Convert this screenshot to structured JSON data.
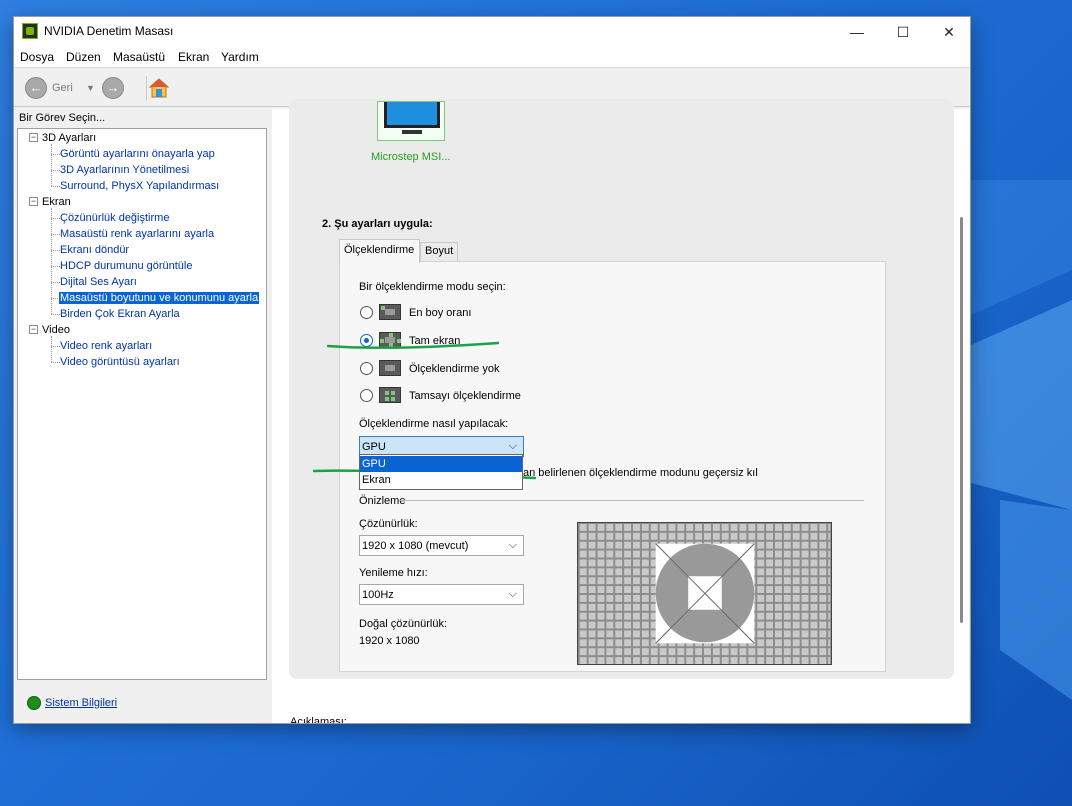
{
  "window": {
    "title": "NVIDIA Denetim Masası",
    "controls": {
      "minimize": "—",
      "maximize": "☐",
      "close": "✕"
    }
  },
  "menu": [
    "Dosya",
    "Düzen",
    "Masaüstü",
    "Ekran",
    "Yardım"
  ],
  "toolbar": {
    "back_label": "Geri",
    "back_icon": "back-arrow-icon",
    "forward_icon": "forward-arrow-icon",
    "home_icon": "home-icon"
  },
  "sidebar": {
    "title": "Bir Görev Seçin...",
    "groups": [
      {
        "label": "3D Ayarları",
        "items": [
          "Görüntü ayarlarını önayarla yap",
          "3D Ayarlarının Yönetilmesi",
          "Surround, PhysX Yapılandırması"
        ]
      },
      {
        "label": "Ekran",
        "items": [
          "Çözünürlük değiştirme",
          "Masaüstü renk ayarlarını ayarla",
          "Ekranı döndür",
          "HDCP durumunu görüntüle",
          "Dijital Ses Ayarı",
          "Masaüstü boyutunu ve konumunu ayarla",
          "Birden Çok Ekran Ayarla"
        ]
      },
      {
        "label": "Video",
        "items": [
          "Video renk ayarları",
          "Video görüntüsü ayarları"
        ]
      }
    ],
    "selected": "Masaüstü boyutunu ve konumunu ayarla",
    "system_info": "Sistem Bilgileri"
  },
  "content": {
    "display_name": "Microstep MSI...",
    "step_title": "2. Şu ayarları uygula:",
    "tabs": [
      "Ölçeklendirme",
      "Boyut"
    ],
    "mode_prompt": "Bir ölçeklendirme modu seçin:",
    "modes": [
      "En boy oranı",
      "Tam ekran",
      "Ölçeklendirme yok",
      "Tamsayı ölçeklendirme"
    ],
    "selected_mode": "Tam ekran",
    "method_label": "Ölçeklendirme nasıl yapılacak:",
    "method_value": "GPU",
    "method_options": [
      "GPU",
      "Ekran"
    ],
    "override_text": "an belirlenen ölçeklendirme modunu geçersiz kıl",
    "preview_label": "Önizleme",
    "resolution_label": "Çözünürlük:",
    "resolution_value": "1920 x 1080 (mevcut)",
    "refresh_label": "Yenileme hızı:",
    "refresh_value": "100Hz",
    "native_label": "Doğal çözünürlük:",
    "native_value": "1920 x 1080",
    "description_label": "Açıklaması:"
  },
  "colors": {
    "accent": "#0a64d4",
    "nvidia_green": "#76b900",
    "annotation_green": "#1aa34a"
  }
}
